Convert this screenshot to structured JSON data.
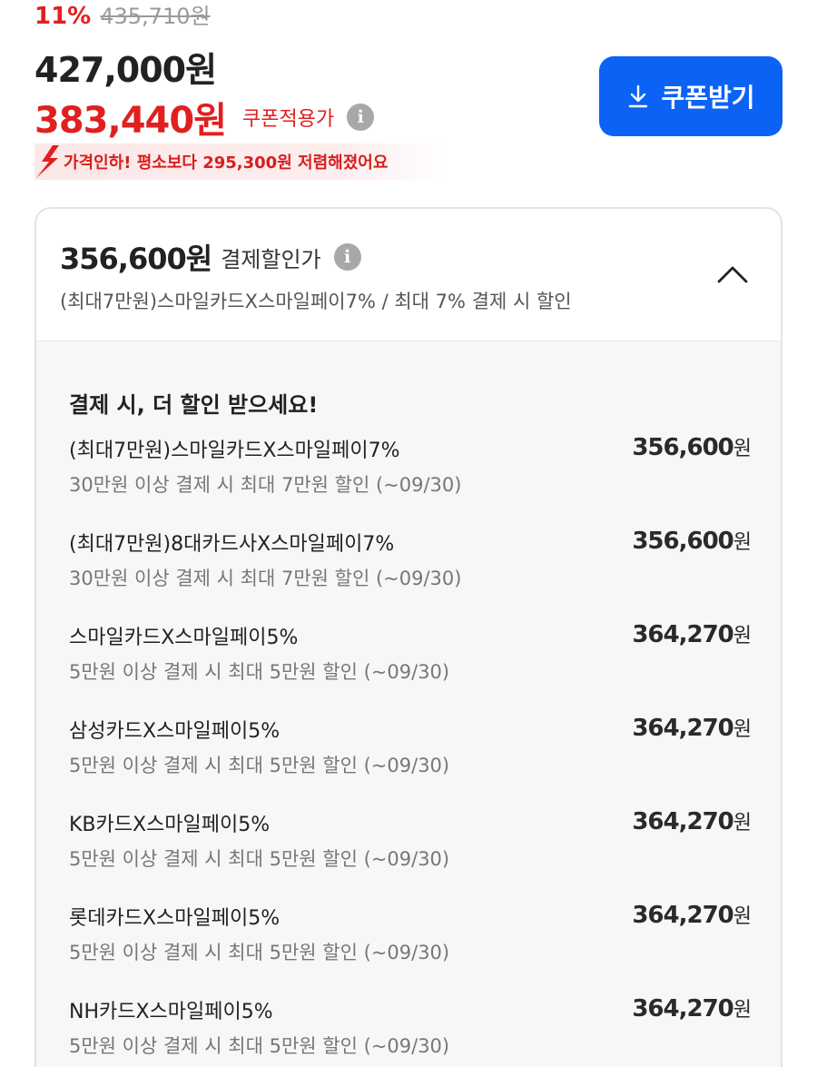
{
  "price": {
    "discount_rate": "11%",
    "original_price": "435,710원",
    "sale_price": "427,000원",
    "coupon_price": "383,440원",
    "coupon_label": "쿠폰적용가",
    "info_symbol": "i"
  },
  "coupon_button": {
    "label": "쿠폰받기",
    "icon": "download-icon"
  },
  "price_drop": {
    "text": "가격인하! 평소보다 295,300원 저렴해졌어요",
    "icon": "arrow-down-icon"
  },
  "payment_discount": {
    "price": "356,600원",
    "label": "결제할인가",
    "subtitle": "(최대7만원)스마일카드X스마일페이7% / 최대 7% 결제 시 할인",
    "collapse_icon": "chevron-up-icon",
    "heading": "결제 시, 더 할인 받으세요!",
    "offers": [
      {
        "name": "(최대7만원)스마일카드X스마일페이7%",
        "desc": "30만원 이상 결제 시 최대 7만원 할인 (~09/30)",
        "amount": "356,600",
        "unit": "원"
      },
      {
        "name": "(최대7만원)8대카드사X스마일페이7%",
        "desc": "30만원 이상 결제 시 최대 7만원 할인 (~09/30)",
        "amount": "356,600",
        "unit": "원"
      },
      {
        "name": "스마일카드X스마일페이5%",
        "desc": "5만원 이상 결제 시 최대 5만원 할인 (~09/30)",
        "amount": "364,270",
        "unit": "원"
      },
      {
        "name": "삼성카드X스마일페이5%",
        "desc": "5만원 이상 결제 시 최대 5만원 할인 (~09/30)",
        "amount": "364,270",
        "unit": "원"
      },
      {
        "name": "KB카드X스마일페이5%",
        "desc": "5만원 이상 결제 시 최대 5만원 할인 (~09/30)",
        "amount": "364,270",
        "unit": "원"
      },
      {
        "name": "롯데카드X스마일페이5%",
        "desc": "5만원 이상 결제 시 최대 5만원 할인 (~09/30)",
        "amount": "364,270",
        "unit": "원"
      },
      {
        "name": "NH카드X스마일페이5%",
        "desc": "5만원 이상 결제 시 최대 5만원 할인 (~09/30)",
        "amount": "364,270",
        "unit": "원"
      }
    ]
  },
  "colors": {
    "accent_red": "#e02020",
    "button_blue": "#0b63f6",
    "banner_bg": "#fde7e7"
  }
}
